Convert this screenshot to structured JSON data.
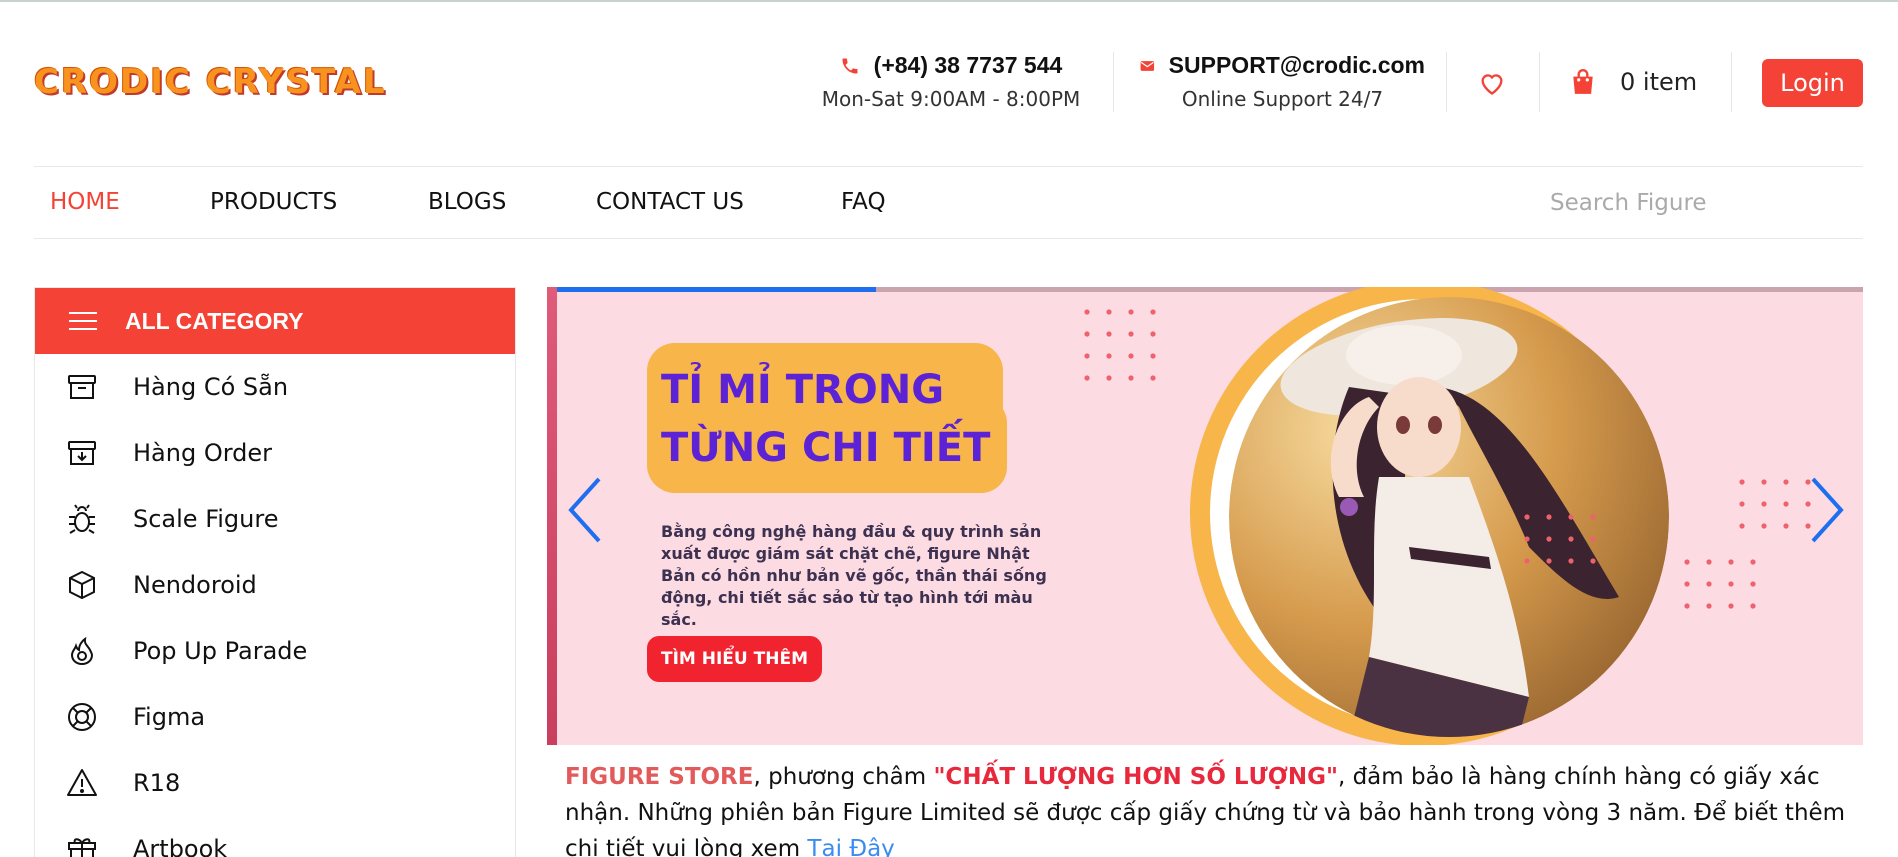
{
  "header": {
    "logo_text": "CRODIC CRYSTAL",
    "phone": {
      "number": "(+84) 38 7737 544",
      "hours": "Mon-Sat 9:00AM - 8:00PM",
      "icon": "phone-icon"
    },
    "email": {
      "address": "SUPPORT@crodic.com",
      "note": "Online Support 24/7",
      "icon": "mail-icon"
    },
    "wishlist_icon": "heart-icon",
    "cart": {
      "icon": "shopping-bag-icon",
      "label": "0 item"
    },
    "login_label": "Login"
  },
  "nav": {
    "items": [
      {
        "label": "HOME",
        "active": true
      },
      {
        "label": "PRODUCTS",
        "active": false
      },
      {
        "label": "BLOGS",
        "active": false
      },
      {
        "label": "CONTACT US",
        "active": false
      },
      {
        "label": "FAQ",
        "active": false
      }
    ],
    "search_placeholder": "Search Figure"
  },
  "sidebar": {
    "header": "ALL CATEGORY",
    "header_icon": "hamburger-menu-icon",
    "items": [
      {
        "label": "Hàng Có Sẵn",
        "icon": "archive-box-icon"
      },
      {
        "label": "Hàng Order",
        "icon": "archive-download-icon"
      },
      {
        "label": "Scale Figure",
        "icon": "bug-icon"
      },
      {
        "label": "Nendoroid",
        "icon": "cube-icon"
      },
      {
        "label": "Pop Up Parade",
        "icon": "fire-icon"
      },
      {
        "label": "Figma",
        "icon": "lifebuoy-icon"
      },
      {
        "label": "R18",
        "icon": "warning-icon"
      },
      {
        "label": "Artbook",
        "icon": "gift-icon"
      }
    ]
  },
  "banner": {
    "headline": "TỈ MỈ TRONG TỪNG CHI TIẾT",
    "description": "Bằng công nghệ hàng đầu & quy trình sản xuất được giám sát chặt chẽ, figure Nhật Bản có hồn như bản vẽ gốc, thần thái sống động, chi tiết sắc sảo từ tạo hình tới màu sắc.",
    "cta_label": "TÌM HIỂU THÊM",
    "progress": 0.25,
    "colors": {
      "bg": "#fcdbe3",
      "accent": "#f7b54a",
      "headline": "#5b22d6",
      "cta": "#f0232f"
    }
  },
  "intro": {
    "brand": "FIGURE STORE",
    "text1": ", phương châm ",
    "quote": "\"CHẤT LƯỢNG HƠN SỐ LƯỢNG\"",
    "text2": ", đảm bảo là hàng chính hàng có giấy xác nhận. Những phiên bản Figure Limited sẽ được cấp giấy chứng từ và bảo hành trong vòng 3 năm. Để biết thêm chi tiết vui lòng xem ",
    "link": "Tại Đây"
  },
  "colors": {
    "accent": "#f44336",
    "link": "#3b8cf0"
  }
}
